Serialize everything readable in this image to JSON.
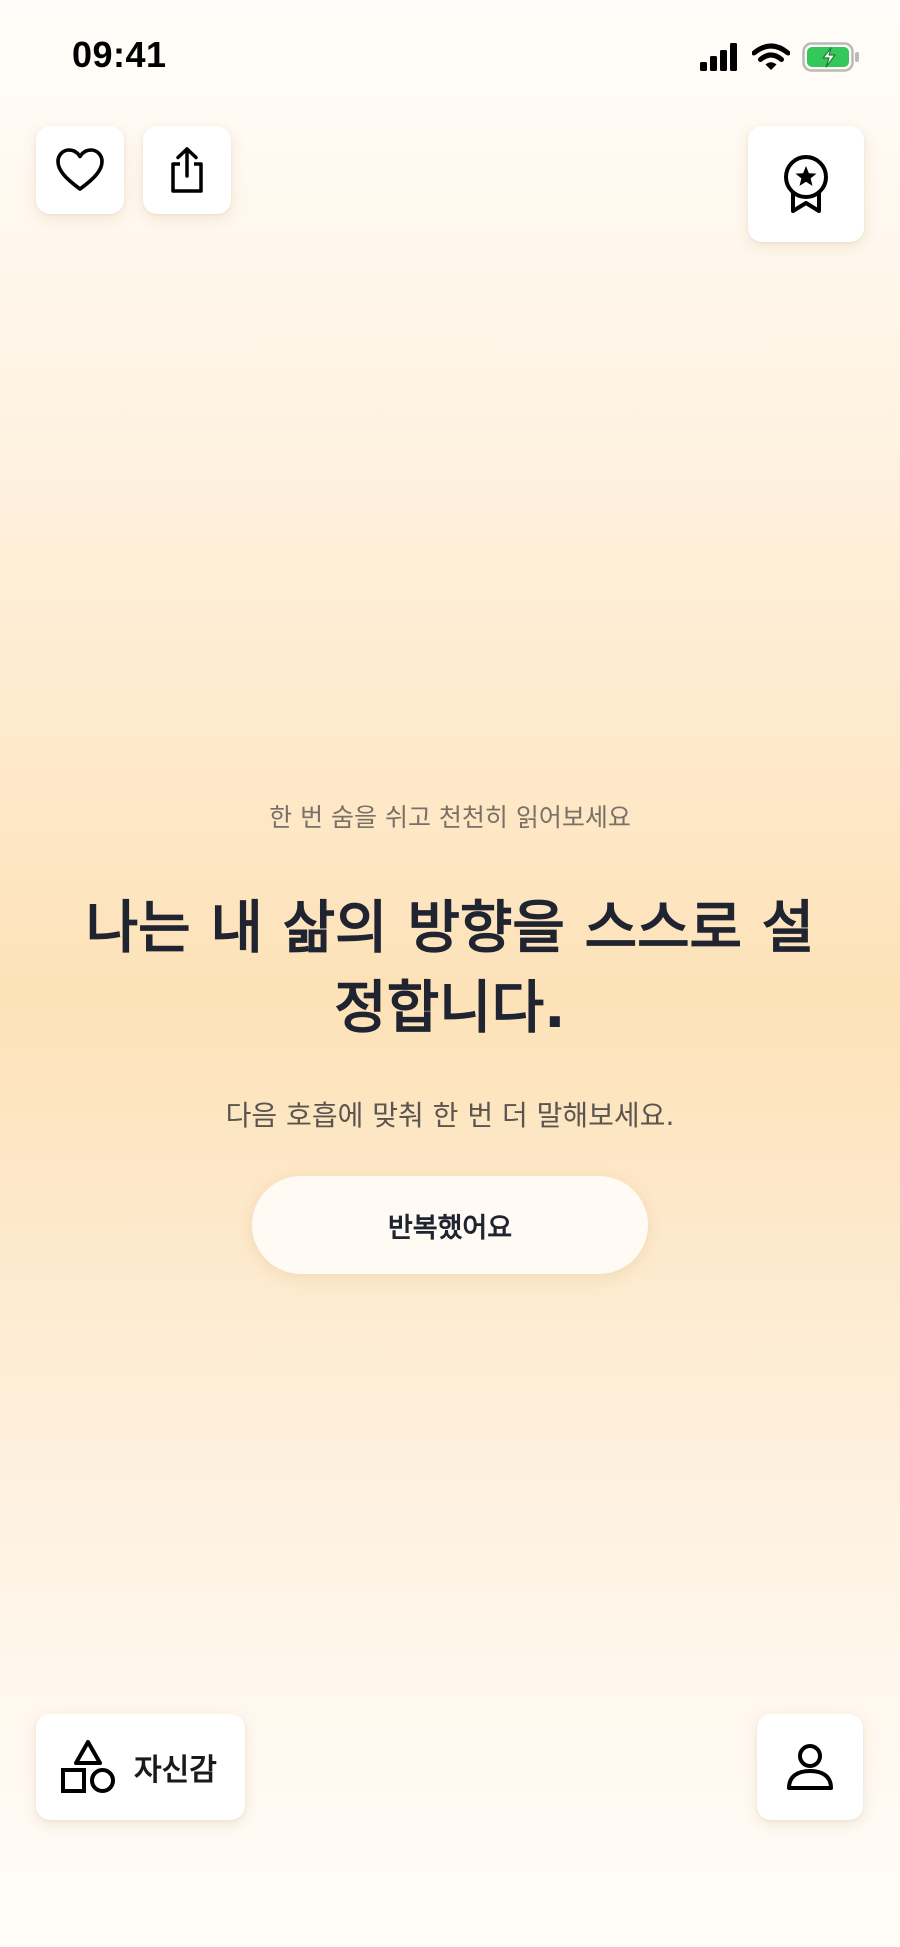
{
  "status_bar": {
    "time": "09:41",
    "icons": [
      "cellular-signal-icon",
      "wifi-icon",
      "battery-charging-icon"
    ],
    "battery_color": "#34c759"
  },
  "top_actions": {
    "favorite_icon": "heart-icon",
    "share_icon": "share-icon",
    "award_icon": "award-ribbon-icon"
  },
  "main": {
    "hint": "한 번 숨을 쉬고 천천히 읽어보세요",
    "affirmation": "나는 내 삶의 방향을 스스로 설정합니다.",
    "instruction": "다음 호흡에 맞춰 한 번 더 말해보세요.",
    "repeat_button_label": "반복했어요"
  },
  "bottom_bar": {
    "category_icon": "shapes-icon",
    "category_label": "자신감",
    "profile_icon": "person-icon"
  },
  "colors": {
    "background_peak": "#fde2b8",
    "text_primary": "#1f2430",
    "text_secondary": "#7a7067"
  }
}
